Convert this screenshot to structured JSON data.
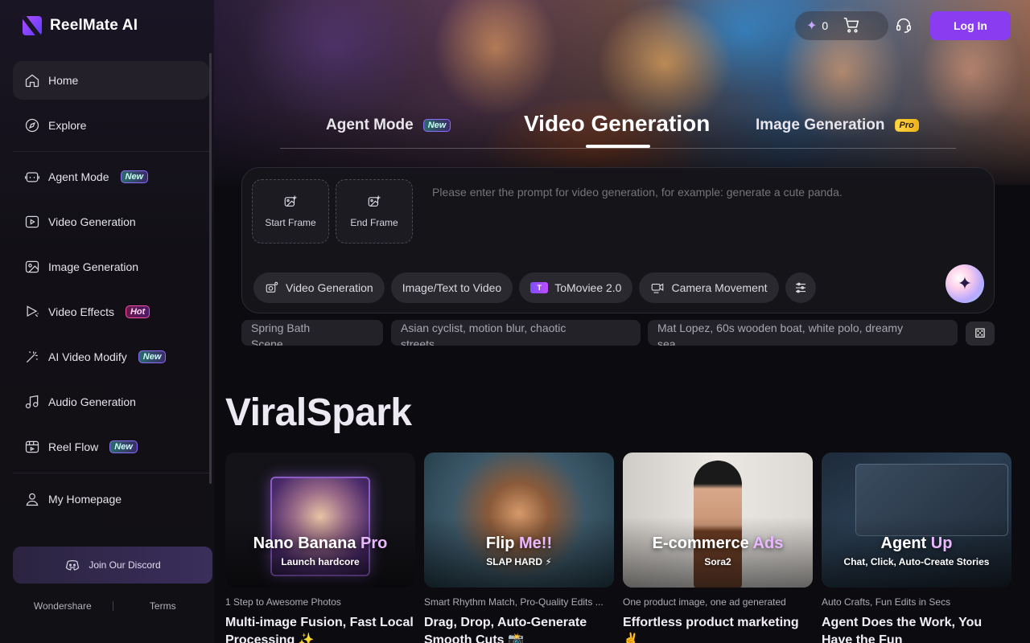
{
  "app": {
    "name": "ReelMate AI"
  },
  "sidebar": {
    "items": [
      {
        "label": "Home",
        "icon": "home-icon",
        "active": true
      },
      {
        "label": "Explore",
        "icon": "compass-icon"
      },
      {
        "label": "Agent Mode",
        "icon": "agent-icon",
        "badge": "New"
      },
      {
        "label": "Video Generation",
        "icon": "video-icon"
      },
      {
        "label": "Image Generation",
        "icon": "image-icon"
      },
      {
        "label": "Video Effects",
        "icon": "effects-icon",
        "badge": "Hot"
      },
      {
        "label": "AI Video Modify",
        "icon": "magic-wand-icon",
        "badge": "New"
      },
      {
        "label": "Audio Generation",
        "icon": "music-note-icon"
      },
      {
        "label": "Reel Flow",
        "icon": "reel-flow-icon",
        "badge": "New"
      },
      {
        "label": "My Homepage",
        "icon": "user-icon"
      }
    ],
    "discord_label": "Join Our Discord",
    "footer": {
      "brand": "Wondershare",
      "terms": "Terms"
    }
  },
  "header": {
    "credits": "0",
    "login_label": "Log In"
  },
  "tabs": [
    {
      "label": "Agent Mode",
      "badge": "New"
    },
    {
      "label": "Video Generation",
      "active": true
    },
    {
      "label": "Image Generation",
      "badge": "Pro"
    }
  ],
  "prompt": {
    "start_frame": "Start Frame",
    "end_frame": "End Frame",
    "placeholder": "Please enter the prompt for video generation, for example: generate a cute panda.",
    "chips": {
      "mode": "Video Generation",
      "source": "Image/Text to Video",
      "model": "ToMoviee 2.0",
      "model_logo": "T",
      "camera": "Camera Movement"
    }
  },
  "suggestions": [
    [
      "Spring Bath",
      "Scene"
    ],
    [
      "Asian cyclist, motion blur, chaotic",
      "streets."
    ],
    [
      "Mat Lopez, 60s wooden boat, white polo, dreamy",
      "sea."
    ]
  ],
  "section": {
    "title": "ViralSpark"
  },
  "cards": [
    {
      "head": "Nano Banana",
      "head_hl": "Pro",
      "sub": "Launch hardcore",
      "caption": "1 Step to Awesome Photos",
      "title": "Multi-image Fusion, Fast Local Processing ✨"
    },
    {
      "head": "Flip",
      "head_hl": "Me!!",
      "sub": "SLAP HARD ⚡",
      "caption": "Smart Rhythm Match, Pro-Quality Edits ...",
      "title": "Drag, Drop, Auto-Generate Smooth Cuts 📸"
    },
    {
      "head": "E-commerce",
      "head_hl": "Ads",
      "sub": "Sora2",
      "caption": "One product image, one ad generated",
      "title": "Effortless product marketing ✌️"
    },
    {
      "head": "Agent",
      "head_hl": "Up",
      "sub": "Chat, Click, Auto-Create Stories",
      "caption": "Auto Crafts, Fun Edits in Secs",
      "title": "Agent Does the Work, You Have the Fun"
    }
  ],
  "colors": {
    "accent": "#8a3cf0",
    "background": "#0c0b10",
    "sidebar": "#121016"
  }
}
